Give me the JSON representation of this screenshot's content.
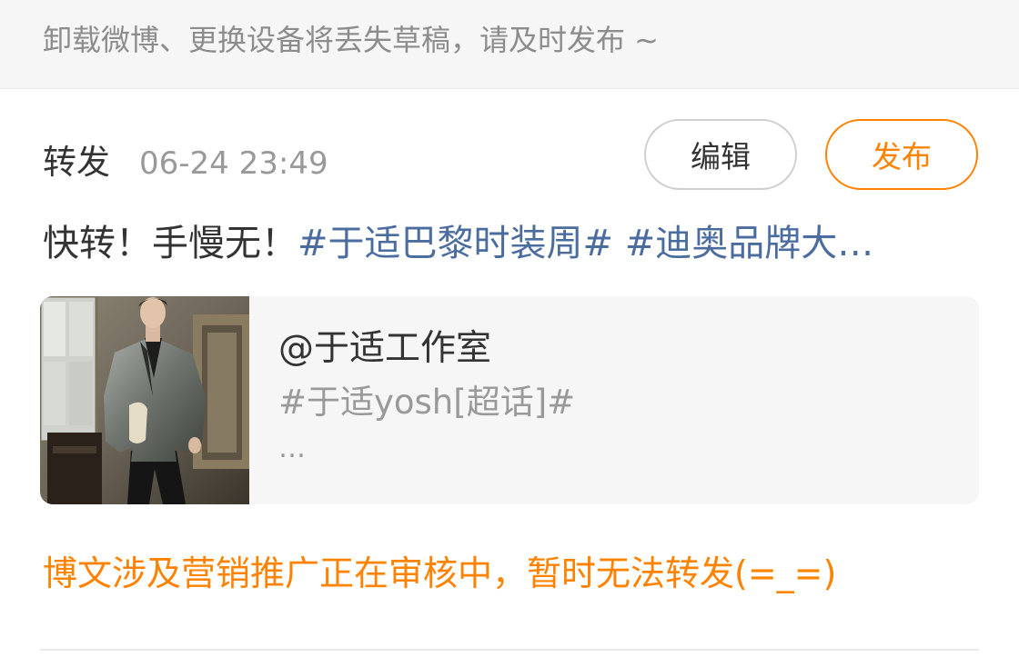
{
  "notice": {
    "text": "卸载微博、更换设备将丢失草稿，请及时发布 ~"
  },
  "draft": {
    "type_label": "转发",
    "timestamp": "06-24 23:49",
    "edit_label": "编辑",
    "publish_label": "发布",
    "text_plain": "快转！手慢无！",
    "topic_1": "#于适巴黎时装周#",
    "topic_2": "#迪奥品牌大…"
  },
  "quoted_post": {
    "author": "@于适工作室",
    "topic": "#于适yosh[超话]#",
    "ellipsis": "…",
    "thumbnail": "image"
  },
  "warning": {
    "text": "博文涉及营销推广正在审核中，暂时无法转发(=_=)"
  },
  "colors": {
    "accent": "#ff8200",
    "topic_link": "#4a6c9f",
    "muted_text": "#999999",
    "notice_bg": "#f6f6f6"
  }
}
